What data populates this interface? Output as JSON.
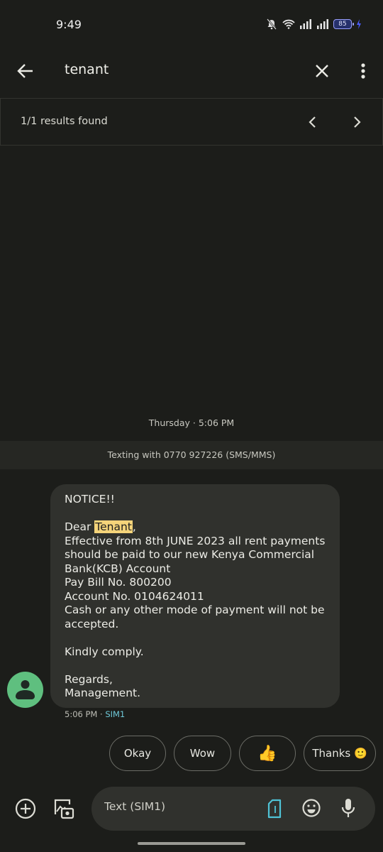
{
  "status_bar": {
    "time": "9:49",
    "battery_level": "85",
    "icons": [
      "silent-bell-icon",
      "wifi-icon",
      "signal-sim1-icon",
      "signal-sim2-icon",
      "battery-icon",
      "charging-bolt-icon"
    ]
  },
  "search": {
    "query": "tenant",
    "results_text": "1/1 results found",
    "icons": [
      "back-arrow-icon",
      "close-icon",
      "more-vert-icon",
      "chevron-left-icon",
      "chevron-right-icon"
    ]
  },
  "conversation": {
    "date_separator": "Thursday · 5:06 PM",
    "texting_banner": "Texting with 0770 927226 (SMS/MMS)",
    "message": {
      "line_notice": "NOTICE!!",
      "greeting_prefix": "Dear ",
      "highlight": "Tenant",
      "greeting_suffix": ",",
      "body": "Effective from 8th JUNE 2023 all rent payments should be paid to our new Kenya Commercial Bank(KCB) Account\nPay Bill No. 800200\nAccount No. 0104624011\nCash or any other mode of payment will not be accepted.\n\nKindly comply.\n\nRegards,\nManagement.",
      "time": "5:06 PM",
      "separator": " · ",
      "sim": "SIM1"
    }
  },
  "smart_replies": [
    {
      "label": "Okay"
    },
    {
      "label": "Wow"
    },
    {
      "label": "👍"
    },
    {
      "label": "Thanks 🙂"
    }
  ],
  "composer": {
    "placeholder": "Text (SIM1)",
    "value": "",
    "sim_label": "1",
    "sim_color": "#4fc3d6"
  }
}
